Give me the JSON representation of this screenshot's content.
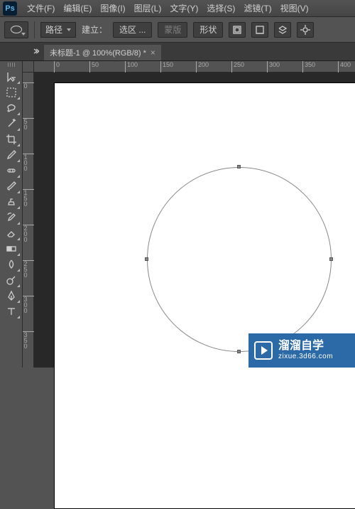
{
  "app": {
    "logo": "Ps"
  },
  "menu": {
    "file": "文件(F)",
    "edit": "编辑(E)",
    "image": "图像(I)",
    "layer": "图层(L)",
    "type": "文字(Y)",
    "select": "选择(S)",
    "filter": "滤镜(T)",
    "view": "视图(V)"
  },
  "options": {
    "mode_value": "路径",
    "build_label": "建立：",
    "selection_btn": "选区 ...",
    "mask_btn": "蒙版",
    "shape_btn": "形状"
  },
  "document": {
    "tab_title": "未标题-1 @ 100%(RGB/8) *"
  },
  "ruler_h": [
    "0",
    "50",
    "100",
    "150",
    "200",
    "250",
    "300",
    "350",
    "400"
  ],
  "ruler_v": [
    "0",
    "50",
    "100",
    "150",
    "200",
    "250",
    "300",
    "350"
  ],
  "watermark": {
    "title": "溜溜自学",
    "sub": "zixue.3d66.com"
  },
  "icons": {
    "ellipse": "ellipse-icon",
    "align_left": "align-left-icon",
    "align_center": "align-center-icon",
    "layers": "layers-stack-icon",
    "gear": "gear-icon"
  }
}
